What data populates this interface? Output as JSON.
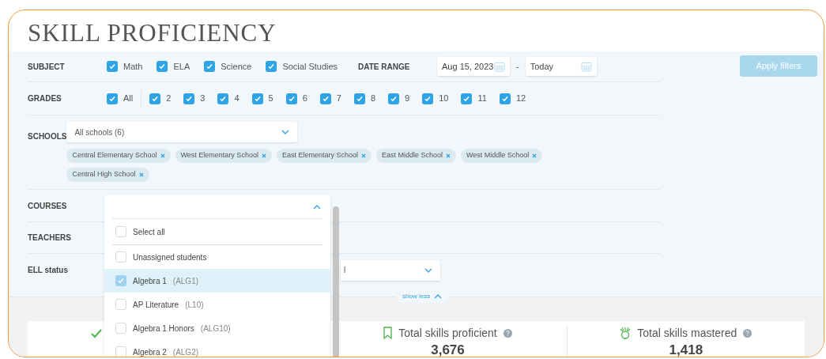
{
  "title": "SKILL PROFICIENCY",
  "filters": {
    "subject": {
      "label": "SUBJECT",
      "options": [
        {
          "label": "Math",
          "checked": true
        },
        {
          "label": "ELA",
          "checked": true
        },
        {
          "label": "Science",
          "checked": true
        },
        {
          "label": "Social Studies",
          "checked": true
        }
      ]
    },
    "date_range": {
      "label": "DATE RANGE",
      "from": "Aug 15, 2023",
      "separator": "-",
      "to": "Today"
    },
    "apply_button": {
      "label": "Apply filters",
      "disabled": true
    },
    "grades": {
      "label": "GRADES",
      "all": {
        "label": "All",
        "checked": true
      },
      "options": [
        {
          "label": "2",
          "checked": true
        },
        {
          "label": "3",
          "checked": true
        },
        {
          "label": "4",
          "checked": true
        },
        {
          "label": "5",
          "checked": true
        },
        {
          "label": "6",
          "checked": true
        },
        {
          "label": "7",
          "checked": true
        },
        {
          "label": "8",
          "checked": true
        },
        {
          "label": "9",
          "checked": true
        },
        {
          "label": "10",
          "checked": true
        },
        {
          "label": "11",
          "checked": true
        },
        {
          "label": "12",
          "checked": true
        }
      ]
    },
    "schools": {
      "label": "SCHOOLS",
      "value": "All schools (6)",
      "tags": [
        "Central Elementary School",
        "West Elementary School",
        "East Elementary School",
        "East Middle School",
        "West Middle School",
        "Central High School"
      ]
    },
    "courses": {
      "label": "COURSES",
      "dropdown": {
        "open": true,
        "select_all": {
          "label": "Select all",
          "checked": false
        },
        "options": [
          {
            "label": "Unassigned students",
            "checked": false,
            "highlighted": false
          },
          {
            "label": "Algebra 1",
            "code": "(ALG1)",
            "checked": true,
            "highlighted": true
          },
          {
            "label": "AP Literature",
            "code": "(L10)",
            "checked": false,
            "highlighted": false
          },
          {
            "label": "Algebra 1 Honors",
            "code": "(ALG10)",
            "checked": false,
            "highlighted": false
          },
          {
            "label": "Algebra 2",
            "code": "(ALG2)",
            "checked": false,
            "highlighted": false
          }
        ]
      }
    },
    "teachers": {
      "label": "TEACHERS"
    },
    "ell_status": {
      "label": "ELL status",
      "value": "l"
    },
    "toggle": {
      "label": "show less",
      "expanded": true
    }
  },
  "stats": [
    {
      "kind": "check"
    },
    {
      "label": "Total skills proficient",
      "value": "3,676",
      "kind": "bookmark"
    },
    {
      "label": "Total skills mastered",
      "value": "1,418",
      "kind": "medal"
    }
  ]
}
